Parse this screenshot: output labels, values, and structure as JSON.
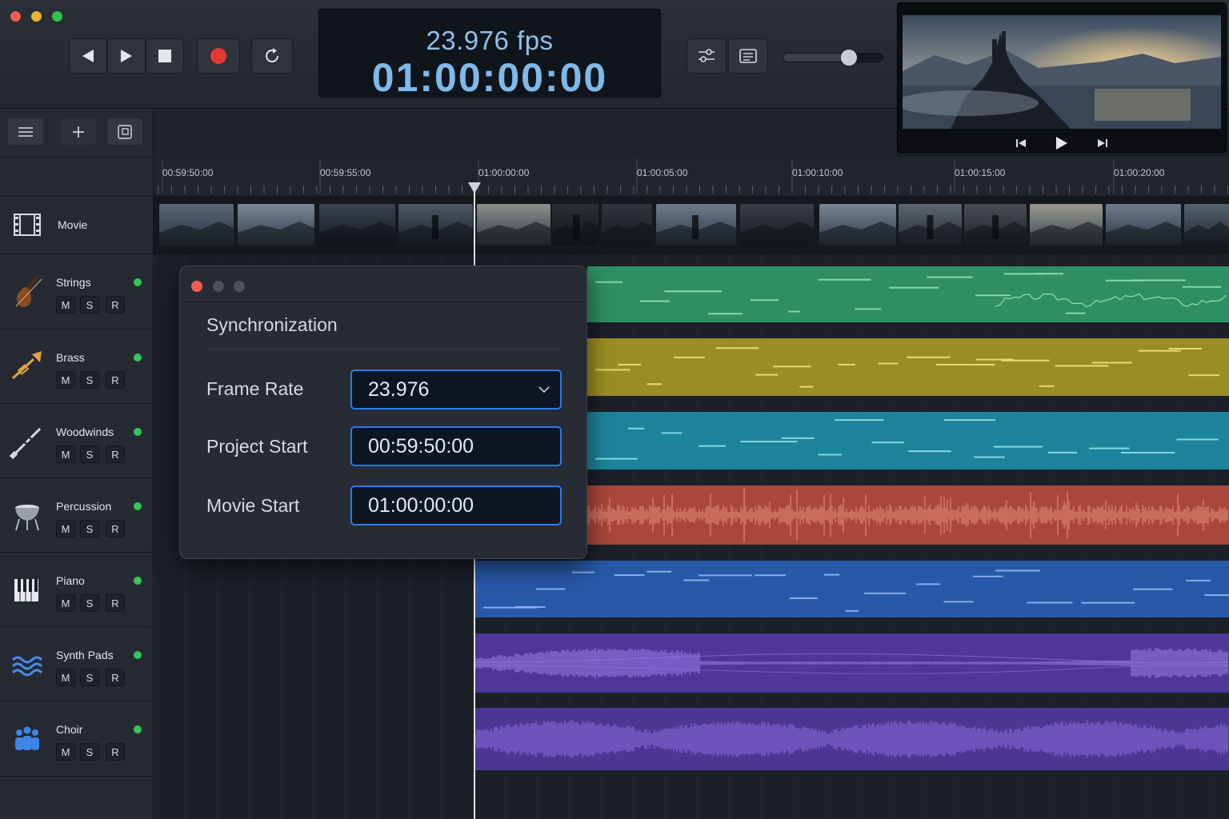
{
  "transport": {
    "fps_text": "23.976 fps",
    "timecode": "01:00:00:00",
    "buttons": [
      "rewind",
      "play",
      "stop",
      "record",
      "cycle"
    ],
    "volume_level": 0.66
  },
  "ruler": {
    "ticks": [
      "00:59:50:00",
      "00:59:55:00",
      "01:00:00:00",
      "01:00:05:00",
      "01:00:10:00",
      "01:00:15:00",
      "01:00:20:00"
    ]
  },
  "tracks": [
    {
      "name": "Movie",
      "icon": "film-icon"
    },
    {
      "name": "Strings",
      "icon": "violin-icon",
      "color": "#2f9a6c"
    },
    {
      "name": "Brass",
      "icon": "trumpet-icon",
      "color": "#a69a2a"
    },
    {
      "name": "Woodwinds",
      "icon": "clarinet-icon",
      "color": "#1f8fa6"
    },
    {
      "name": "Percussion",
      "icon": "timpani-icon",
      "color": "#b4503f"
    },
    {
      "name": "Piano",
      "icon": "piano-icon",
      "color": "#2b63b8"
    },
    {
      "name": "Synth Pads",
      "icon": "waves-icon",
      "color": "#5a3fa8"
    },
    {
      "name": "Choir",
      "icon": "choir-icon",
      "color": "#5a3fa8"
    }
  ],
  "track_buttons": {
    "mute": "M",
    "solo": "S",
    "record": "R"
  },
  "sync_dialog": {
    "title": "Synchronization",
    "frame_rate_label": "Frame Rate",
    "frame_rate_value": "23.976",
    "project_start_label": "Project Start",
    "project_start_value": "00:59:50:00",
    "movie_start_label": "Movie Start",
    "movie_start_value": "01:00:00:00"
  },
  "colors": {
    "accent_blue": "#2a7af0",
    "record_red": "#e23b36",
    "active_green": "#34c759"
  }
}
